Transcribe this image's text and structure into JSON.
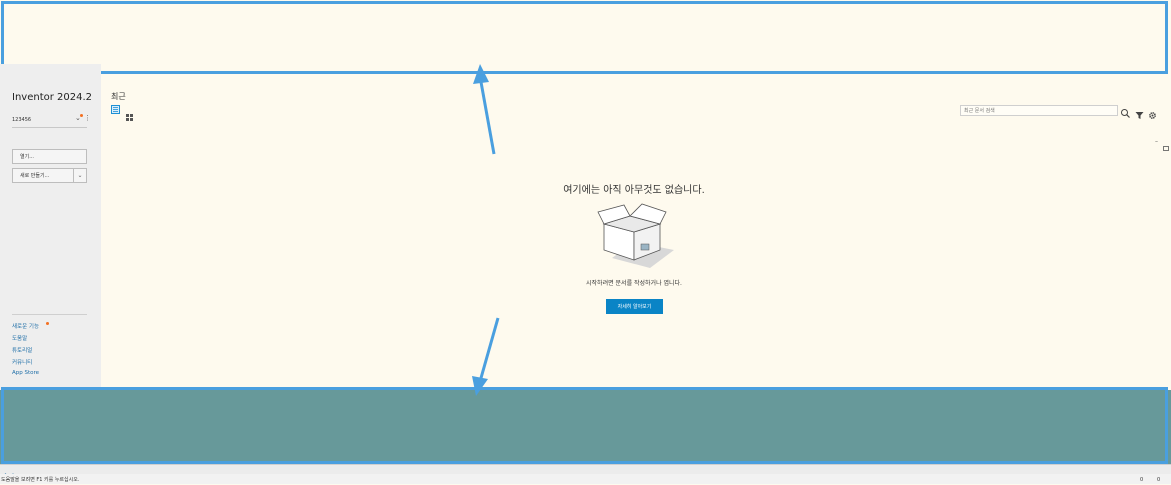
{
  "app": {
    "title": "Inventor 2024.2",
    "account_id": "123456"
  },
  "sidebar": {
    "open_label": "열기...",
    "new_label": "새로 만들기...",
    "links": [
      {
        "label": "새로운 기능"
      },
      {
        "label": "도움말"
      },
      {
        "label": "튜토리얼"
      },
      {
        "label": "커뮤니티"
      },
      {
        "label": "App Store"
      }
    ]
  },
  "main": {
    "recent_title": "최근",
    "search": {
      "placeholder": "최근 문서 검색",
      "value": ""
    },
    "empty_message": "여기에는 아직 아무것도 없습니다.",
    "start_message": "시작하려면 문서를 작성하거나 엽니다.",
    "learn_more_label": "자세히 알아보기"
  },
  "status": {
    "text": "도움말을 보려면 F1 키를 누르십시오.",
    "count_a": "0",
    "count_b": "0"
  },
  "colors": {
    "accent": "#0a84c6",
    "background": "#fefaee",
    "sidebar": "#eeeeee",
    "bottom_panel": "#67999a",
    "highlight": "#4a9fdf",
    "notify_dot": "#f37021"
  }
}
